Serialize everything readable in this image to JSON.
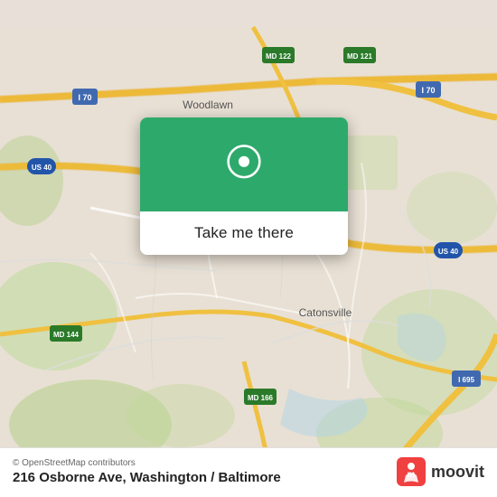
{
  "map": {
    "alt": "Street map of Catonsville / Baltimore area"
  },
  "card": {
    "icon_label": "location-pin",
    "button_label": "Take me there"
  },
  "bottom_bar": {
    "copyright": "© OpenStreetMap contributors",
    "address": "216 Osborne Ave, Washington / Baltimore",
    "moovit_label": "moovit"
  }
}
